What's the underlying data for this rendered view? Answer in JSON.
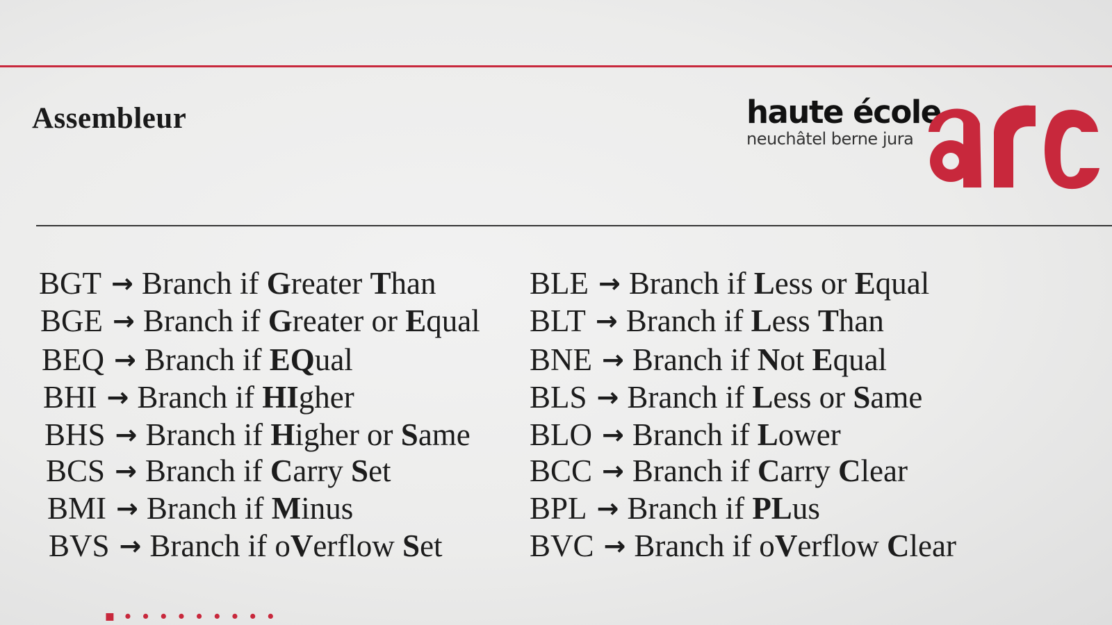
{
  "header": {
    "title": "Assembleur",
    "logo": {
      "name": "haute école",
      "subtitle": "neuchâtel berne jura",
      "mark_text": "arc",
      "brand_color": "#c8283c"
    }
  },
  "arrow_symbol": "→",
  "instructions": {
    "left": [
      {
        "code": "BGT",
        "desc": "Branch if **G**reater **T**han"
      },
      {
        "code": "BGE",
        "desc": "Branch if **G**reater or **E**qual"
      },
      {
        "code": "BEQ",
        "desc": "Branch if **EQ**ual"
      },
      {
        "code": "BHI",
        "desc": "Branch if **HI**gher"
      },
      {
        "code": "BHS",
        "desc": "Branch if **H**igher or **S**ame"
      },
      {
        "code": "BCS",
        "desc": "Branch if **C**arry **S**et"
      },
      {
        "code": "BMI",
        "desc": "Branch if **M**inus"
      },
      {
        "code": "BVS",
        "desc": "Branch if o**V**erflow **S**et"
      }
    ],
    "right": [
      {
        "code": "BLE",
        "desc": "Branch if **L**ess or **E**qual"
      },
      {
        "code": "BLT",
        "desc": "Branch if **L**ess **T**han"
      },
      {
        "code": "BNE",
        "desc": "Branch if **N**ot **E**qual"
      },
      {
        "code": "BLS",
        "desc": "Branch if **L**ess or **S**ame"
      },
      {
        "code": "BLO",
        "desc": "Branch if **L**ower"
      },
      {
        "code": "BCC",
        "desc": "Branch if **C**arry **C**lear"
      },
      {
        "code": "BPL",
        "desc": "Branch if **PL**us"
      },
      {
        "code": "BVC",
        "desc": "Branch if o**V**erflow **C**lear"
      }
    ]
  }
}
